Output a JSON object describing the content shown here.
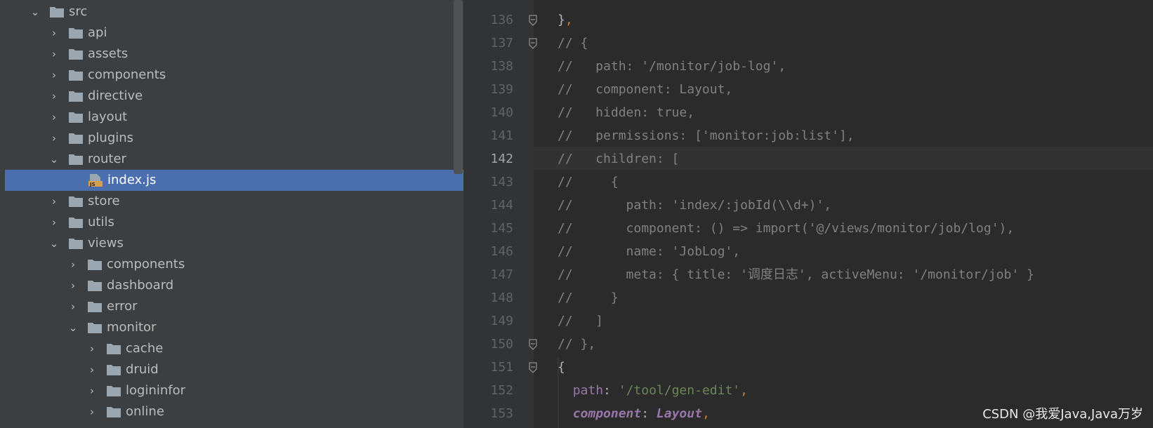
{
  "tree": {
    "items": [
      {
        "label": "src",
        "expanded": true,
        "type": "folder"
      },
      {
        "label": "api",
        "expanded": false,
        "type": "folder"
      },
      {
        "label": "assets",
        "expanded": false,
        "type": "folder"
      },
      {
        "label": "components",
        "expanded": false,
        "type": "folder"
      },
      {
        "label": "directive",
        "expanded": false,
        "type": "folder"
      },
      {
        "label": "layout",
        "expanded": false,
        "type": "folder"
      },
      {
        "label": "plugins",
        "expanded": false,
        "type": "folder"
      },
      {
        "label": "router",
        "expanded": true,
        "type": "folder"
      },
      {
        "label": "index.js",
        "type": "js-file",
        "selected": true
      },
      {
        "label": "store",
        "expanded": false,
        "type": "folder"
      },
      {
        "label": "utils",
        "expanded": false,
        "type": "folder"
      },
      {
        "label": "views",
        "expanded": true,
        "type": "folder"
      },
      {
        "label": "components",
        "expanded": false,
        "type": "folder"
      },
      {
        "label": "dashboard",
        "expanded": false,
        "type": "folder"
      },
      {
        "label": "error",
        "expanded": false,
        "type": "folder"
      },
      {
        "label": "monitor",
        "expanded": true,
        "type": "folder"
      },
      {
        "label": "cache",
        "expanded": false,
        "type": "folder"
      },
      {
        "label": "druid",
        "expanded": false,
        "type": "folder"
      },
      {
        "label": "logininfor",
        "expanded": false,
        "type": "folder"
      },
      {
        "label": "online",
        "expanded": false,
        "type": "folder"
      }
    ]
  },
  "editor": {
    "current_line": "142",
    "lines": [
      {
        "num": "136",
        "fold": true,
        "segments": [
          {
            "t": "}",
            "c": "c-punct"
          },
          {
            "t": ",",
            "c": "c-orange"
          }
        ]
      },
      {
        "num": "137",
        "fold": true,
        "segments": [
          {
            "t": "// {",
            "c": "c-comment"
          }
        ]
      },
      {
        "num": "138",
        "segments": [
          {
            "t": "//   path: '/monitor/job-log',",
            "c": "c-comment"
          }
        ]
      },
      {
        "num": "139",
        "segments": [
          {
            "t": "//   component: Layout,",
            "c": "c-comment"
          }
        ]
      },
      {
        "num": "140",
        "segments": [
          {
            "t": "//   hidden: true,",
            "c": "c-comment"
          }
        ]
      },
      {
        "num": "141",
        "segments": [
          {
            "t": "//   permissions: ['monitor:job:list'],",
            "c": "c-comment"
          }
        ]
      },
      {
        "num": "142",
        "segments": [
          {
            "t": "//   children: [",
            "c": "c-comment"
          }
        ]
      },
      {
        "num": "143",
        "segments": [
          {
            "t": "//     {",
            "c": "c-comment"
          }
        ]
      },
      {
        "num": "144",
        "segments": [
          {
            "t": "//       path: 'index/:jobId(\\\\d+)',",
            "c": "c-comment"
          }
        ]
      },
      {
        "num": "145",
        "segments": [
          {
            "t": "//       component: () => import('@/views/monitor/job/log'),",
            "c": "c-comment"
          }
        ]
      },
      {
        "num": "146",
        "segments": [
          {
            "t": "//       name: 'JobLog',",
            "c": "c-comment"
          }
        ]
      },
      {
        "num": "147",
        "segments": [
          {
            "t": "//       meta: { title: '调度日志', activeMenu: '/monitor/job' }",
            "c": "c-comment"
          }
        ]
      },
      {
        "num": "148",
        "segments": [
          {
            "t": "//     }",
            "c": "c-comment"
          }
        ]
      },
      {
        "num": "149",
        "segments": [
          {
            "t": "//   ]",
            "c": "c-comment"
          }
        ]
      },
      {
        "num": "150",
        "fold": true,
        "segments": [
          {
            "t": "// },",
            "c": "c-comment"
          }
        ]
      },
      {
        "num": "151",
        "fold": true,
        "segments": [
          {
            "t": "{",
            "c": "c-punct"
          }
        ]
      },
      {
        "num": "152",
        "segments": [
          {
            "t": "  ",
            "c": "c-punct"
          },
          {
            "t": "path",
            "c": "c-key"
          },
          {
            "t": ": ",
            "c": "c-punct"
          },
          {
            "t": "'/tool/gen-edit'",
            "c": "c-str"
          },
          {
            "t": ",",
            "c": "c-orange"
          }
        ]
      },
      {
        "num": "153",
        "segments": [
          {
            "t": "  ",
            "c": "c-punct"
          },
          {
            "t": "component",
            "c": "c-italic"
          },
          {
            "t": ": ",
            "c": "c-punct"
          },
          {
            "t": "Layout",
            "c": "c-italic"
          },
          {
            "t": ",",
            "c": "c-orange"
          }
        ]
      }
    ]
  },
  "watermark": "CSDN @我爱Java,Java万岁",
  "colors": {
    "tree_bg": "#3c3f41",
    "selection": "#4b6eaf",
    "editor_bg": "#2b2b2b",
    "folder_icon": "#9aa7b0"
  },
  "icons": {
    "folder": "folder-icon",
    "js_file": "js-file-icon",
    "chevron_right": "chevron-right-icon",
    "chevron_down": "chevron-down-icon",
    "fold_marker": "fold-marker-icon"
  }
}
